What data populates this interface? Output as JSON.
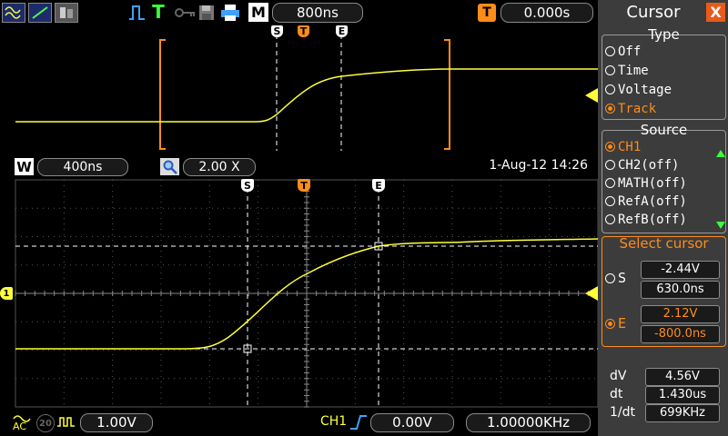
{
  "top_bar": {
    "mode_label": "M",
    "timebase": "800ns",
    "trig_icon": "T",
    "trig_offset": "0.000s"
  },
  "zoom_bar": {
    "window_label": "W",
    "window_timebase": "400ns",
    "zoom_factor": "2.00 X",
    "datetime": "1-Aug-12 14:26"
  },
  "bottom_bar": {
    "coupling": "AC",
    "bw_limit": "20",
    "ch1_scale": "1.00V",
    "trig_source": "CH1",
    "trig_level": "0.00V",
    "frequency": "1.00000KHz"
  },
  "markers": {
    "start": "S",
    "trigger": "T",
    "end": "E",
    "channel": "1"
  },
  "cursor_panel": {
    "title": "Cursor",
    "close": "X",
    "type_title": "Type",
    "type_options": [
      "Off",
      "Time",
      "Voltage",
      "Track"
    ],
    "type_selected": 3,
    "source_title": "Source",
    "source_options": [
      "CH1",
      "CH2(off)",
      "MATH(off)",
      "RefA(off)",
      "RefB(off)"
    ],
    "source_selected": 0,
    "select_title": "Select cursor",
    "s_label": "S",
    "s_voltage": "-2.44V",
    "s_time": "630.0ns",
    "e_label": "E",
    "e_voltage": "2.12V",
    "e_time": "-800.0ns",
    "dv_label": "dV",
    "dv_value": "4.56V",
    "dt_label": "dt",
    "dt_value": "1.430us",
    "inv_dt_label": "1/dt",
    "inv_dt_value": "699KHz"
  },
  "colors": {
    "trace": "#ffff3c",
    "accent": "#ff8c1a",
    "panel": "#3c3c3c"
  }
}
